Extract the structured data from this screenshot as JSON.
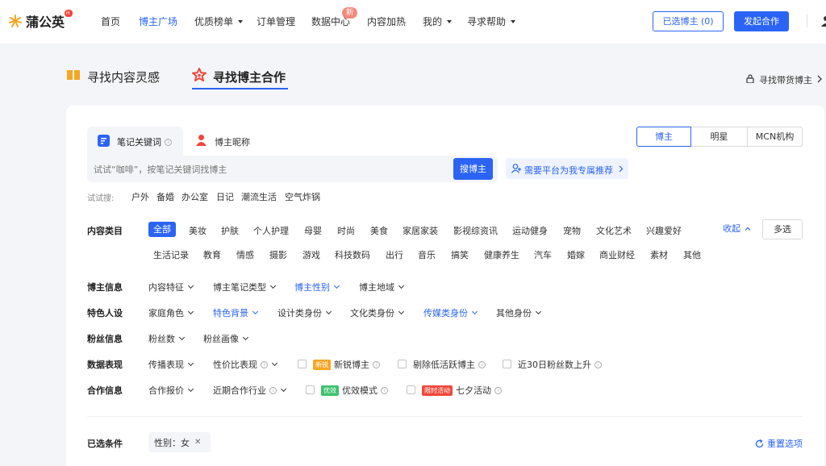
{
  "header": {
    "logo_text": "蒲公英",
    "logo_badge": "H出品",
    "nav": [
      {
        "label": "首页",
        "active": false,
        "caret": false
      },
      {
        "label": "博主广场",
        "active": true,
        "caret": false
      },
      {
        "label": "优质榜单",
        "active": false,
        "caret": true
      },
      {
        "label": "订单管理",
        "active": false,
        "caret": false
      },
      {
        "label": "数据中心",
        "active": false,
        "caret": false
      },
      {
        "label": "内容加热",
        "active": false,
        "caret": false
      },
      {
        "label": "我的",
        "active": false,
        "caret": true
      },
      {
        "label": "寻求帮助",
        "active": false,
        "caret": true
      }
    ],
    "new_badge": "新",
    "selected_btn": "已选博主 (0)",
    "launch_btn": "发起合作"
  },
  "page_tabs": {
    "inspiration": "寻找内容灵感",
    "find_blogger": "寻找博主合作",
    "goods_link": "寻找带货博主"
  },
  "search": {
    "tab_keyword": "笔记关键词",
    "tab_nickname": "博主昵称",
    "placeholder": "试试“咖啡”，按笔记关键词找博主",
    "button": "搜博主",
    "recommend": "需要平台为我专属推荐",
    "try_label": "试试搜:",
    "try_words": [
      "户外",
      "备婚",
      "办公室",
      "日记",
      "潮流生活",
      "空气炸锅"
    ],
    "segments": [
      "博主",
      "明星",
      "MCN机构"
    ]
  },
  "category": {
    "label": "内容类目",
    "row1": [
      "全部",
      "美妆",
      "护肤",
      "个人护理",
      "母婴",
      "时尚",
      "美食",
      "家居家装",
      "影视综资讯",
      "运动健身",
      "宠物",
      "文化艺术",
      "兴趣爱好"
    ],
    "row2": [
      "生活记录",
      "教育",
      "情感",
      "摄影",
      "游戏",
      "科技数码",
      "出行",
      "音乐",
      "搞笑",
      "健康养生",
      "汽车",
      "婚嫁",
      "商业财经",
      "素材",
      "其他"
    ],
    "collapse": "收起",
    "multi": "多选"
  },
  "filters": {
    "blogger_info": {
      "label": "博主信息",
      "items": [
        "内容特征",
        "博主笔记类型",
        "博主性别",
        "博主地域"
      ]
    },
    "persona": {
      "label": "特色人设",
      "items": [
        "家庭角色",
        "特色背景",
        "设计类身份",
        "文化类身份",
        "传媒类身份",
        "其他身份"
      ]
    },
    "fans": {
      "label": "粉丝信息",
      "items": [
        "粉丝数",
        "粉丝画像"
      ]
    },
    "performance": {
      "label": "数据表现",
      "items": [
        "传播表现",
        "性价比表现"
      ],
      "tag_new": "新锐",
      "new_blogger": "新锐博主",
      "exclude_low": "剔除低活跃博主",
      "fans_up": "近30日粉丝数上升"
    },
    "coop": {
      "label": "合作信息",
      "items": [
        "合作报价",
        "近期合作行业"
      ],
      "tag_eff": "优效",
      "eff_mode": "优效模式",
      "tag_limited": "限时活动",
      "qixi": "七夕活动"
    }
  },
  "selected": {
    "label": "已选条件",
    "chip": "性别：女",
    "reset": "重置选项"
  },
  "colors": {
    "accent": "#2b64f5",
    "red": "#f0483c",
    "orange": "#f5a623",
    "green": "#3ec26b"
  }
}
